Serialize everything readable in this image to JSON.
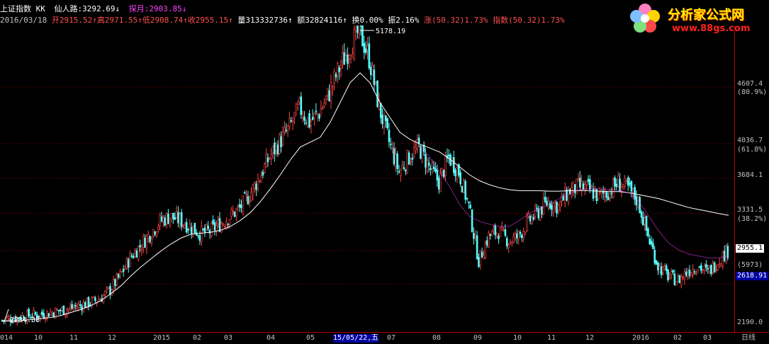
{
  "header": {
    "index_name": "上证指数",
    "formula": "KK",
    "line1_name": "仙人路",
    "line1_value": "3292.69",
    "line1_arrow": "↓",
    "line2_name": "探月",
    "line2_value": "2903.85",
    "line2_arrow": "↓",
    "date": "2016/03/18",
    "open": "开2915.52",
    "open_arrow": "↑",
    "high": "高2971.55",
    "high_arrow": "↑",
    "low": "低2908.74",
    "low_arrow": "↑",
    "close": "收2955.15",
    "close_arrow": "↑",
    "volume": "量313332736",
    "volume_arrow": "↑",
    "amount": "额32824116",
    "amount_arrow": "↑",
    "turnover": "换0.00%",
    "amplitude": "振2.16%",
    "rise": "涨(50.32)1.73%",
    "index_change": "指数(50.32)1.73%"
  },
  "logo": {
    "title": "分析家公式网",
    "url": "www.88gs.com"
  },
  "right_axis": {
    "p4607": "4607.4",
    "p4607_pct": "(80.9%)",
    "p4036": "4036.7",
    "p4036_pct": "(61.8%)",
    "p3684": "3684.1",
    "p3331": "3331.5",
    "p3331_pct": "(38.2%)",
    "current": "2955.1",
    "count": "(5973)",
    "low_mark": "2618.91",
    "p2190": "2190.0"
  },
  "annotations": {
    "peak": "5178.19",
    "trough": "2234.38"
  },
  "x_axis": {
    "labels": [
      "014",
      "10",
      "11",
      "12",
      "2015",
      "02",
      "03",
      "04",
      "05",
      "15/05/22,五",
      "07",
      "08",
      "09",
      "10",
      "11",
      "12",
      "2016",
      "02",
      "03"
    ],
    "period": "日线"
  },
  "colors": {
    "up": "#ff4444",
    "down": "#54ffff",
    "ma_long": "#ffffff",
    "ma_short": "#ff44ff",
    "grid": "#9a0000",
    "background": "#000000"
  },
  "chart_data": {
    "type": "candlestick",
    "ylim": [
      2190,
      5200
    ],
    "fib_levels": [
      4607.4,
      4036.7,
      3684.1,
      3331.5,
      2955.1,
      2618.91
    ],
    "peak": 5178.19,
    "trough": 2234.38,
    "close_path": [
      2250,
      2270,
      2285,
      2300,
      2310,
      2330,
      2350,
      2370,
      2400,
      2430,
      2470,
      2560,
      2700,
      2880,
      3000,
      3120,
      3250,
      3300,
      3260,
      3200,
      3130,
      3150,
      3220,
      3300,
      3380,
      3520,
      3700,
      3900,
      4050,
      4200,
      4400,
      4250,
      4350,
      4550,
      4800,
      5000,
      5178,
      4900,
      4400,
      4050,
      3750,
      3900,
      4000,
      3800,
      3650,
      3900,
      3750,
      3400,
      2850,
      3100,
      3150,
      3050,
      3100,
      3250,
      3350,
      3450,
      3400,
      3550,
      3600,
      3580,
      3500,
      3550,
      3640,
      3580,
      3450,
      3100,
      2800,
      2700,
      2650,
      2750,
      2800,
      2730,
      2850,
      2955
    ],
    "ma_long_path": [
      2240,
      2245,
      2250,
      2258,
      2268,
      2280,
      2300,
      2330,
      2360,
      2400,
      2450,
      2520,
      2600,
      2700,
      2790,
      2870,
      2950,
      3020,
      3080,
      3120,
      3130,
      3140,
      3160,
      3200,
      3260,
      3340,
      3450,
      3580,
      3720,
      3870,
      4000,
      4050,
      4100,
      4250,
      4450,
      4650,
      4750,
      4650,
      4450,
      4300,
      4150,
      4080,
      4030,
      3990,
      3950,
      3880,
      3800,
      3720,
      3660,
      3620,
      3590,
      3570,
      3560,
      3560,
      3560,
      3555,
      3555,
      3560,
      3560,
      3560,
      3555,
      3550,
      3550,
      3540,
      3520,
      3500,
      3480,
      3450,
      3420,
      3390,
      3370,
      3350,
      3330,
      3310
    ],
    "ma_short_path": [
      null,
      null,
      null,
      null,
      null,
      null,
      null,
      null,
      null,
      null,
      null,
      null,
      null,
      null,
      null,
      null,
      null,
      null,
      null,
      null,
      null,
      null,
      null,
      null,
      null,
      null,
      null,
      null,
      null,
      null,
      null,
      null,
      null,
      null,
      null,
      null,
      null,
      null,
      null,
      null,
      null,
      null,
      4000,
      3900,
      3750,
      3600,
      3420,
      3300,
      3250,
      3220,
      3200,
      3200,
      3260,
      3330,
      3380,
      3420,
      3480,
      3530,
      3570,
      3580,
      3580,
      3570,
      3560,
      3540,
      3450,
      3300,
      3150,
      3030,
      2960,
      2920,
      2900,
      2880,
      2880,
      2903
    ]
  }
}
